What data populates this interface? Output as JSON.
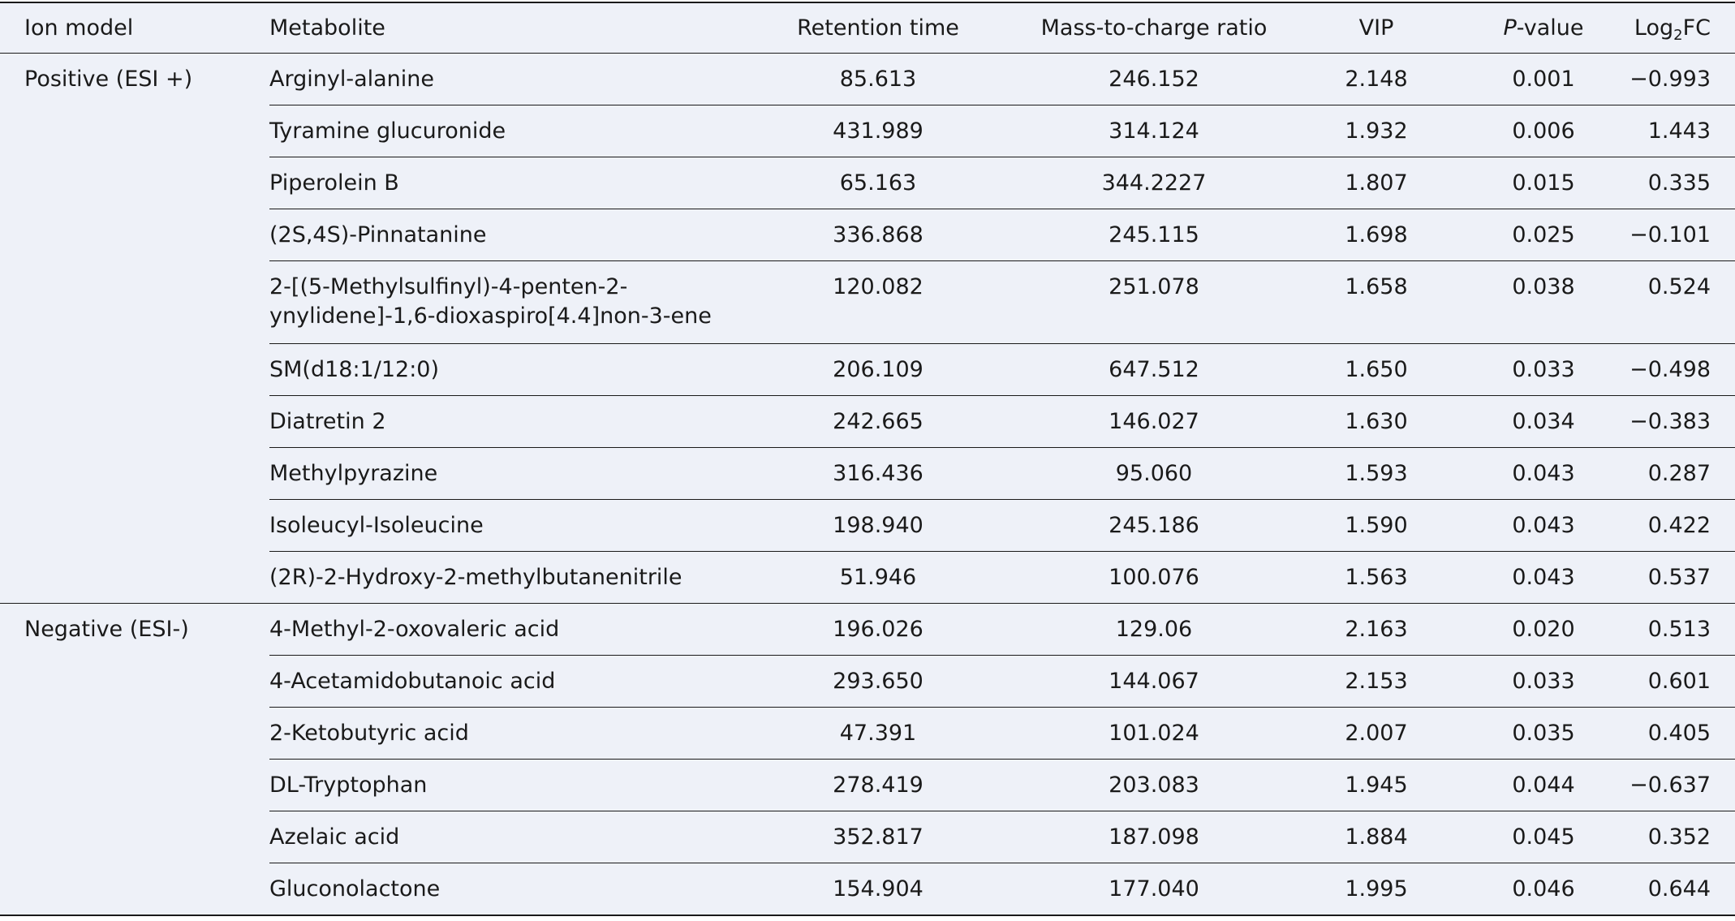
{
  "header": {
    "ion_model": "Ion model",
    "metabolite": "Metabolite",
    "retention_time": "Retention time",
    "mz": "Mass-to-charge ratio",
    "vip": "VIP",
    "p_italic": "P",
    "p_rest": "-value",
    "log_pre": "Log",
    "log_sub": "2",
    "log_post": "FC"
  },
  "groups": [
    {
      "label": "Positive (ESI +)",
      "rows": [
        {
          "metabolite": "Arginyl-alanine",
          "rt": "85.613",
          "mz": "246.152",
          "vip": "2.148",
          "p": "0.001",
          "fc": "−0.993"
        },
        {
          "metabolite": "Tyramine glucuronide",
          "rt": "431.989",
          "mz": "314.124",
          "vip": "1.932",
          "p": "0.006",
          "fc": "1.443"
        },
        {
          "metabolite": "Piperolein B",
          "rt": "65.163",
          "mz": "344.2227",
          "vip": "1.807",
          "p": "0.015",
          "fc": "0.335"
        },
        {
          "metabolite": "(2S,4S)-Pinnatanine",
          "rt": "336.868",
          "mz": "245.115",
          "vip": "1.698",
          "p": "0.025",
          "fc": "−0.101"
        },
        {
          "metabolite": "2-[(5-Methylsulfinyl)-4-penten-2-ynylidene]-1,6-dioxaspiro[4.4]non-3-ene",
          "rt": "120.082",
          "mz": "251.078",
          "vip": "1.658",
          "p": "0.038",
          "fc": "0.524"
        },
        {
          "metabolite": "SM(d18:1/12:0)",
          "rt": "206.109",
          "mz": "647.512",
          "vip": "1.650",
          "p": "0.033",
          "fc": "−0.498"
        },
        {
          "metabolite": "Diatretin 2",
          "rt": "242.665",
          "mz": "146.027",
          "vip": "1.630",
          "p": "0.034",
          "fc": "−0.383"
        },
        {
          "metabolite": "Methylpyrazine",
          "rt": "316.436",
          "mz": "95.060",
          "vip": "1.593",
          "p": "0.043",
          "fc": "0.287"
        },
        {
          "metabolite": "Isoleucyl-Isoleucine",
          "rt": "198.940",
          "mz": "245.186",
          "vip": "1.590",
          "p": "0.043",
          "fc": "0.422"
        },
        {
          "metabolite": "(2R)-2-Hydroxy-2-methylbutanenitrile",
          "rt": "51.946",
          "mz": "100.076",
          "vip": "1.563",
          "p": "0.043",
          "fc": "0.537"
        }
      ]
    },
    {
      "label": "Negative (ESI-)",
      "rows": [
        {
          "metabolite": "4-Methyl-2-oxovaleric acid",
          "rt": "196.026",
          "mz": "129.06",
          "vip": "2.163",
          "p": "0.020",
          "fc": "0.513"
        },
        {
          "metabolite": "4-Acetamidobutanoic acid",
          "rt": "293.650",
          "mz": "144.067",
          "vip": "2.153",
          "p": "0.033",
          "fc": "0.601"
        },
        {
          "metabolite": "2-Ketobutyric acid",
          "rt": "47.391",
          "mz": "101.024",
          "vip": "2.007",
          "p": "0.035",
          "fc": "0.405"
        },
        {
          "metabolite": "DL-Tryptophan",
          "rt": "278.419",
          "mz": "203.083",
          "vip": "1.945",
          "p": "0.044",
          "fc": "−0.637"
        },
        {
          "metabolite": "Azelaic acid",
          "rt": "352.817",
          "mz": "187.098",
          "vip": "1.884",
          "p": "0.045",
          "fc": "0.352"
        },
        {
          "metabolite": "Gluconolactone",
          "rt": "154.904",
          "mz": "177.040",
          "vip": "1.995",
          "p": "0.046",
          "fc": "0.644"
        }
      ]
    }
  ]
}
